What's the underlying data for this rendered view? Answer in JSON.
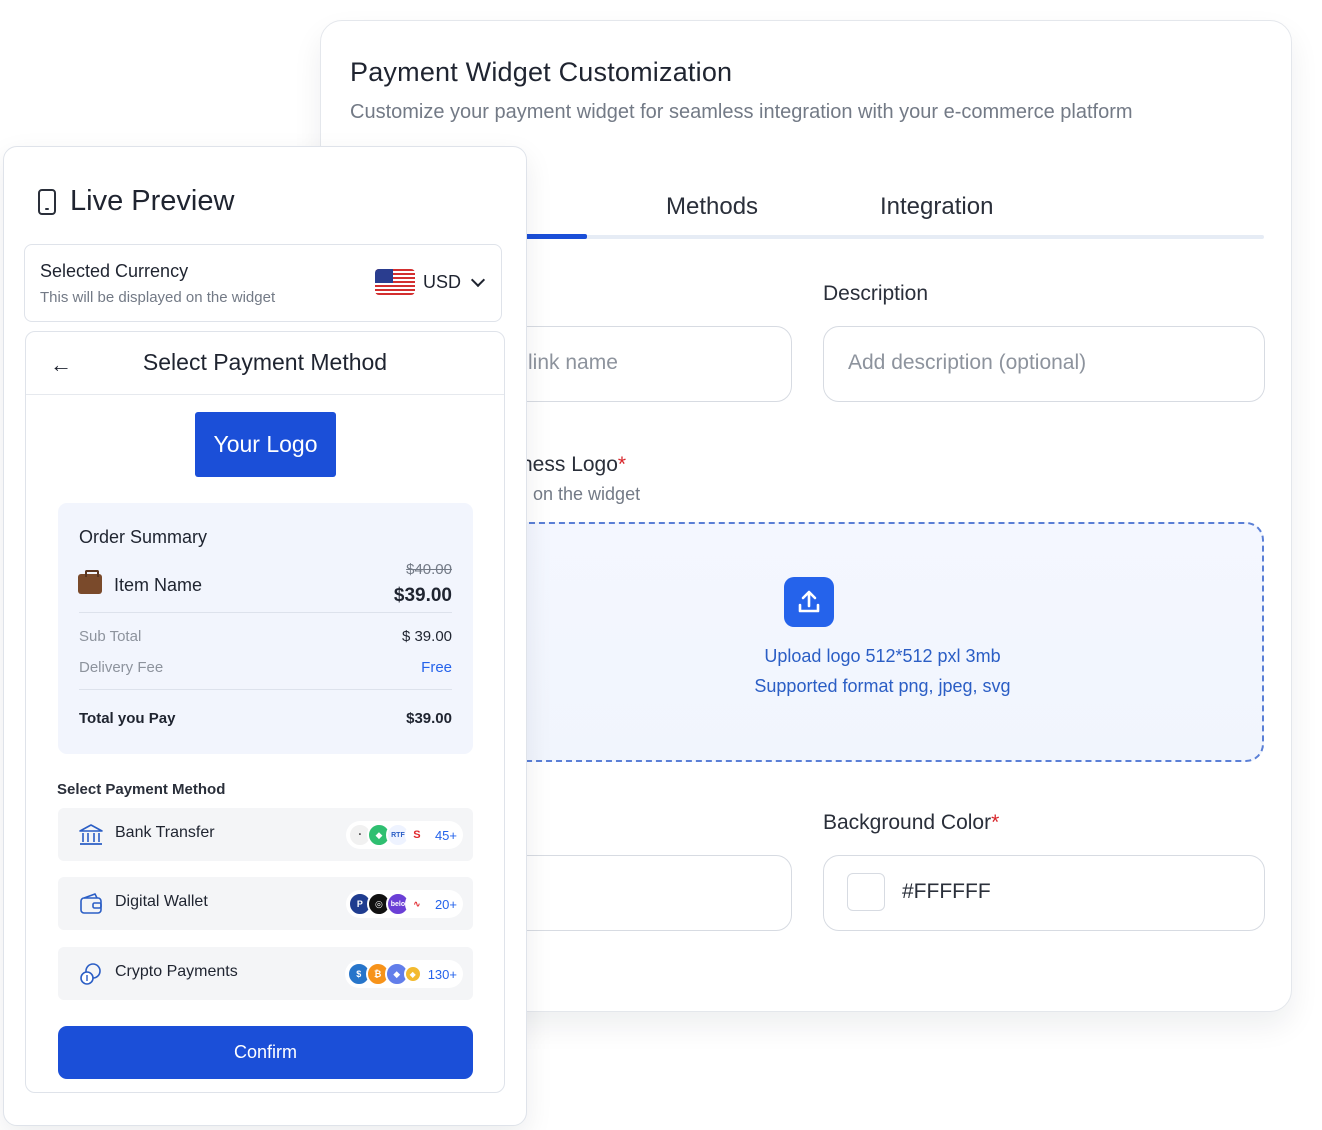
{
  "customization": {
    "title": "Payment Widget Customization",
    "subtitle": "Customize your payment widget for seamless integration with your e-commerce platform",
    "tabs": [
      {
        "label": "Methods"
      },
      {
        "label": "Integration"
      }
    ],
    "fields": {
      "link_name_placeholder": "link name",
      "description_label": "Description",
      "description_placeholder": "Add description (optional)",
      "logo_label_partial": "ness Logo",
      "logo_hint_partial": "on the widget",
      "required_mark": "*",
      "upload_line1": "Upload logo 512*512 pxl 3mb",
      "upload_line2": "Supported format png, jpeg, svg",
      "bg_color_label": "Background Color",
      "bg_color_value": "#FFFFFF"
    },
    "colors": {
      "accent": "#1b4fd8",
      "required": "#d8262b",
      "upload_text": "#2b5ec5"
    }
  },
  "preview": {
    "title": "Live Preview",
    "header_icon": "phone-icon",
    "currency": {
      "label": "Selected Currency",
      "hint": "This will be displayed on the widget",
      "code": "USD",
      "flag_icon": "us-flag-icon"
    },
    "widget": {
      "title": "Select Payment Method",
      "back_icon": "arrow-left-icon",
      "logo_label": "Your Logo",
      "order_summary": {
        "title": "Order Summary",
        "item_icon": "briefcase-icon",
        "item_name": "Item Name",
        "old_price": "$40.00",
        "price": "$39.00",
        "sub_total_label": "Sub Total",
        "sub_total_value": "$ 39.00",
        "delivery_label": "Delivery Fee",
        "delivery_value": "Free",
        "total_label": "Total you Pay",
        "total_value": "$39.00"
      },
      "payment_heading": "Select Payment Method",
      "methods": [
        {
          "label": "Bank Transfer",
          "icon": "bank-icon",
          "count": "45+"
        },
        {
          "label": "Digital Wallet",
          "icon": "wallet-icon",
          "count": "20+"
        },
        {
          "label": "Crypto Payments",
          "icon": "coins-icon",
          "count": "130+"
        }
      ],
      "confirm_label": "Confirm"
    }
  }
}
